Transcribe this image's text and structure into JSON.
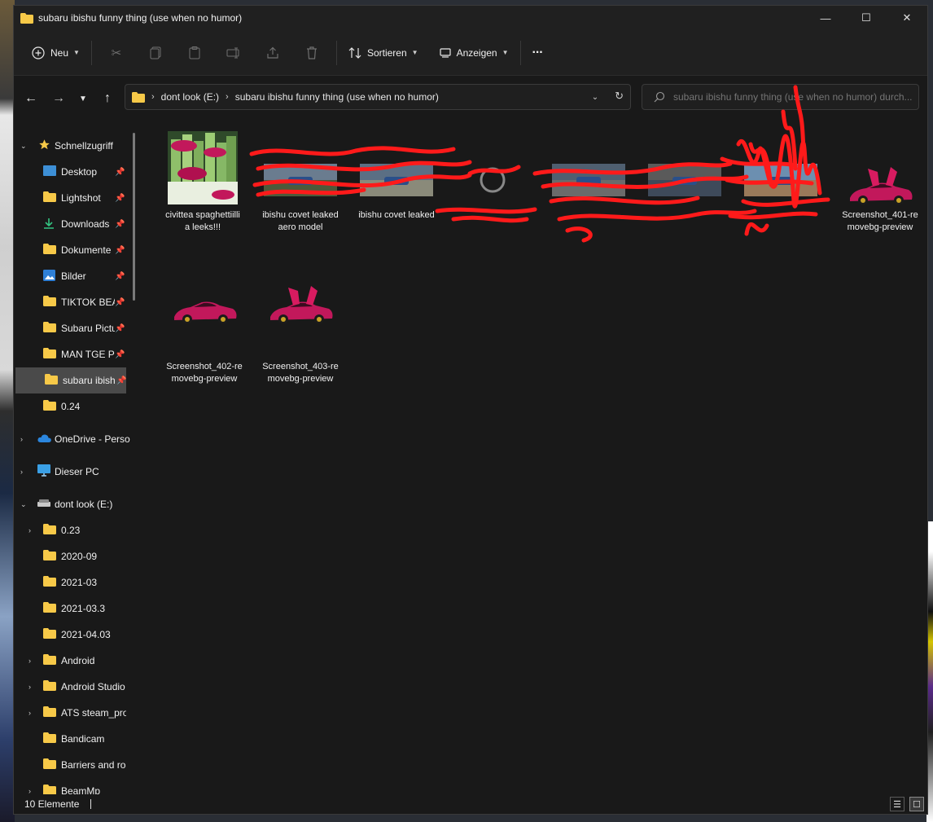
{
  "window": {
    "title": "subaru ibishu funny thing (use when no humor)",
    "controls": {
      "minimize": "—",
      "maximize": "☐",
      "close": "✕"
    }
  },
  "toolbar": {
    "new_label": "Neu",
    "sort_label": "Sortieren",
    "view_label": "Anzeigen",
    "more_label": "···"
  },
  "address": {
    "drive": "dont look (E:)",
    "folder": "subaru ibishu funny thing (use when no humor)"
  },
  "search": {
    "placeholder": "subaru ibishu funny thing (use when no humor) durch..."
  },
  "sidebar": {
    "quick_access": "Schnellzugriff",
    "pinned": [
      {
        "label": "Desktop",
        "icon": "desktop-icon"
      },
      {
        "label": "Lightshot",
        "icon": "folder-icon"
      },
      {
        "label": "Downloads",
        "icon": "download-icon"
      },
      {
        "label": "Dokumente",
        "icon": "document-icon"
      },
      {
        "label": "Bilder",
        "icon": "pictures-icon"
      },
      {
        "label": "TIKTOK BEAI",
        "icon": "folder-icon"
      },
      {
        "label": "Subaru Pictu",
        "icon": "folder-icon"
      },
      {
        "label": "MAN TGE Pi",
        "icon": "folder-icon"
      },
      {
        "label": "subaru ibish",
        "icon": "folder-icon"
      }
    ],
    "recent": [
      {
        "label": "0.24",
        "icon": "folder-icon"
      }
    ],
    "onedrive": "OneDrive - Perso",
    "this_pc": "Dieser PC",
    "drive": "dont look (E:)",
    "drive_folders": [
      {
        "label": "0.23"
      },
      {
        "label": "2020-09"
      },
      {
        "label": "2021-03"
      },
      {
        "label": "2021-03.3"
      },
      {
        "label": "2021-04.03"
      },
      {
        "label": "Android"
      },
      {
        "label": "Android Studio"
      },
      {
        "label": "ATS steam_prof"
      },
      {
        "label": "Bandicam"
      },
      {
        "label": "Barriers and roa"
      },
      {
        "label": "BeamMp"
      }
    ]
  },
  "files": [
    {
      "name": "civittea spaghettiillia leeks!!!"
    },
    {
      "name": "ibishu covet leaked aero model"
    },
    {
      "name": "ibishu covet leaked"
    },
    {
      "name": ""
    },
    {
      "name": ""
    },
    {
      "name": ""
    },
    {
      "name": ""
    },
    {
      "name": "Screenshot_401-removebg-preview"
    },
    {
      "name": "Screenshot_402-removebg-preview"
    },
    {
      "name": "Screenshot_403-removebg-preview"
    }
  ],
  "status": {
    "item_count": "10 Elemente"
  },
  "colors": {
    "accent_folder": "#f7c948",
    "scribble": "#ff1a1a",
    "car": "#c2185b"
  }
}
